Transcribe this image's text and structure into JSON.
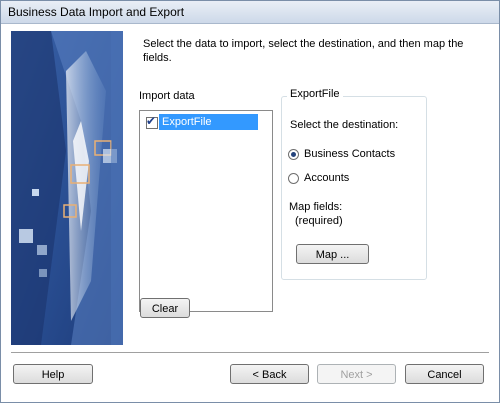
{
  "window": {
    "title": "Business Data Import and Export"
  },
  "instructions": "Select the data to import, select the destination, and then map the fields.",
  "import_data": {
    "label": "Import data",
    "items": [
      {
        "label": "ExportFile",
        "checked": true,
        "selected": true
      }
    ]
  },
  "group": {
    "title": "ExportFile",
    "destination_label": "Select the destination:",
    "options": [
      {
        "label": "Business Contacts",
        "selected": true
      },
      {
        "label": "Accounts",
        "selected": false
      }
    ],
    "map_fields_label": "Map fields:",
    "map_fields_status": "(required)",
    "map_button": "Map ..."
  },
  "buttons": {
    "clear": "Clear",
    "help": "Help",
    "back": "< Back",
    "next": "Next >",
    "cancel": "Cancel"
  },
  "colors": {
    "selection": "#3399ff",
    "banner_dark": "#1f3f7a",
    "banner_light": "#b8cfe6"
  }
}
